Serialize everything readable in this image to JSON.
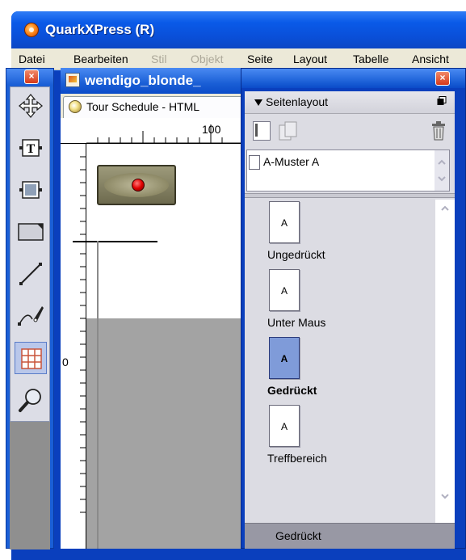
{
  "app": {
    "title": "QuarkXPress (R)"
  },
  "menubar": {
    "items": [
      {
        "label": "Datei",
        "enabled": true
      },
      {
        "label": "Bearbeiten",
        "enabled": true
      },
      {
        "label": "Stil",
        "enabled": false
      },
      {
        "label": "Objekt",
        "enabled": false
      },
      {
        "label": "Seite",
        "enabled": true
      },
      {
        "label": "Layout",
        "enabled": true
      },
      {
        "label": "Tabelle",
        "enabled": true
      },
      {
        "label": "Ansicht",
        "enabled": true
      }
    ]
  },
  "tool_palette": {
    "close_label": "×",
    "tools": [
      {
        "name": "item-tool-icon"
      },
      {
        "name": "text-content-tool-icon"
      },
      {
        "name": "picture-content-tool-icon"
      },
      {
        "name": "rectangle-box-tool-icon"
      },
      {
        "name": "line-tool-icon"
      },
      {
        "name": "bezier-pen-tool-icon"
      },
      {
        "name": "table-tool-icon",
        "selected": true
      },
      {
        "name": "zoom-tool-icon"
      }
    ]
  },
  "document": {
    "title": "wendigo_blonde_",
    "tab_label": "Tour Schedule - HTML",
    "ruler_top_label": "100",
    "ruler_left_label": "0"
  },
  "layout_palette": {
    "close_label": "×",
    "title": "Seitenlayout",
    "master_pages": [
      {
        "label": "A-Muster A"
      }
    ],
    "pages": [
      {
        "thumb": "A",
        "label": "Ungedrückt",
        "state": "normal"
      },
      {
        "thumb": "A",
        "label": "Unter Maus",
        "state": "normal"
      },
      {
        "thumb": "A",
        "label": "Gedrückt",
        "state": "pressed"
      },
      {
        "thumb": "A",
        "label": "Treffbereich",
        "state": "normal"
      }
    ],
    "status": "Gedrückt"
  },
  "colors": {
    "titlebar_blue": "#0a4fd8",
    "menu_bg": "#ece9d8",
    "palette_bg": "#dcdce3",
    "pressed_thumb": "#7f9bd9",
    "status_bg": "#9898a4"
  }
}
